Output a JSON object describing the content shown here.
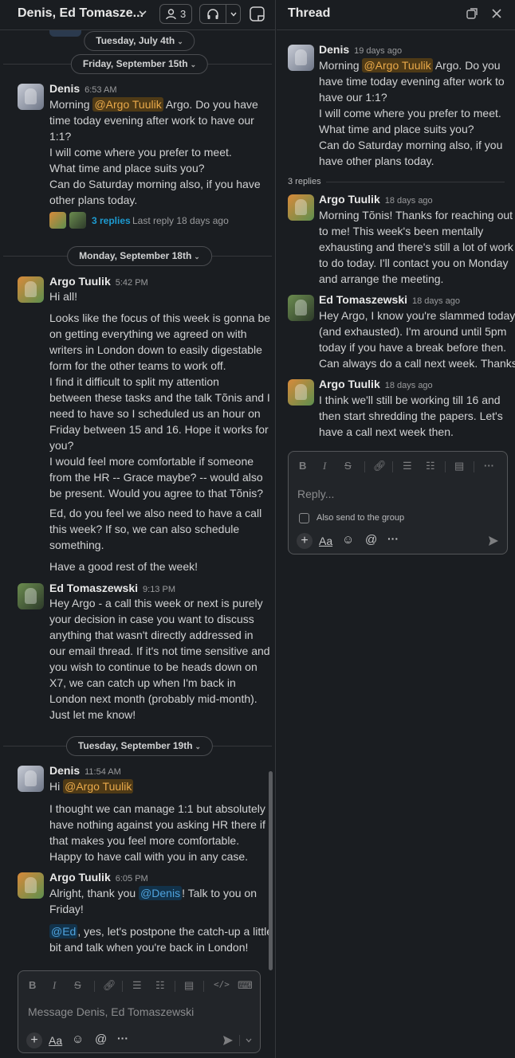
{
  "channel": {
    "title": "Denis, Ed Tomasze...",
    "member_count": "3"
  },
  "thread_panel": {
    "title": "Thread"
  },
  "date_dividers": {
    "d0": "Tuesday, July 4th",
    "d1": "Friday, September 15th",
    "d2": "Monday, September 18th",
    "d3": "Tuesday, September 19th"
  },
  "messages": [
    {
      "author": "Denis",
      "time": "6:53 AM",
      "lines": [
        "Morning ",
        "@Argo Tuulik",
        " Argo. Do you have",
        "time today evening after work to have our",
        "1:1?",
        "I will come where you prefer to meet.",
        "What time and place suits you?",
        "Can do Saturday morning also, if you have",
        "other plans today."
      ],
      "replies": "3 replies",
      "last_reply": "Last reply 18 days ago"
    },
    {
      "author": "Argo Tuulik",
      "time": "5:42 PM",
      "lines": [
        "Hi all!",
        "Looks like the focus of this week is gonna be",
        "on getting everything we agreed on with",
        "writers in London down to easily digestable",
        "form for the other teams to work off.",
        "I find it difficult to split my attention",
        "between these tasks and the talk Tõnis and I",
        "need to have so I scheduled us an hour on",
        "Friday between 15 and 16. Hope it works for",
        "you?",
        "I would feel more comfortable if someone",
        "from the HR -- Grace maybe? -- would also",
        "be present. Would you agree to that Tõnis?",
        "Ed, do you feel we also need to have a call",
        "this week? If so, we can also schedule",
        "something.",
        "Have a good rest of the week!"
      ]
    },
    {
      "author": "Ed Tomaszewski",
      "time": "9:13 PM",
      "lines": [
        "Hey Argo - a call this week or next is purely",
        "your decision in case you want to discuss",
        "anything that wasn't directly addressed in",
        "our email thread. If it's not time sensitive and",
        "you wish to continue to be heads down on",
        "X7, we can catch up when I'm back in",
        "London next month (probably mid-month).",
        "Just let me know!"
      ]
    },
    {
      "author": "Denis",
      "time": "11:54 AM",
      "lines": [
        "Hi ",
        "@Argo Tuulik",
        "I thought we can manage 1:1 but absolutely I",
        "have nothing against you asking HR there if",
        "that makes you feel more comfortable.",
        "Happy to have call with you in any case."
      ]
    },
    {
      "author": "Argo Tuulik",
      "time": "6:05 PM",
      "lines": [
        "Alright, thank you ",
        "@Denis",
        "! Talk to you on",
        "Friday!",
        "@Ed",
        ", yes, let's postpone the catch-up a little",
        "bit and talk when you're back in London!"
      ]
    }
  ],
  "composer": {
    "placeholder": "Message Denis, Ed Tomaszewski"
  },
  "thread": {
    "parent": {
      "author": "Denis",
      "time": "19 days ago",
      "lines": [
        "Morning ",
        "@Argo Tuulik",
        " Argo. Do you",
        "have time today evening after work to",
        "have our 1:1?",
        "I will come where you prefer to meet.",
        "What time and place suits you?",
        "Can do Saturday morning also, if you",
        "have other plans today."
      ]
    },
    "replies_count": "3 replies",
    "replies": [
      {
        "author": "Argo Tuulik",
        "time": "18 days ago",
        "lines": [
          "Morning Tõnis! Thanks for reaching out",
          "to me! This week's been mentally",
          "exhausting and there's still a lot of work",
          "to do today. I'll contact you on Monday",
          "and arrange the meeting."
        ]
      },
      {
        "author": "Ed Tomaszewski",
        "time": "18 days ago",
        "lines": [
          "Hey Argo, I know you're slammed today",
          "(and exhausted). I'm around until 5pm",
          "today if you have a break before then.",
          "Can always do a call next week. Thanks!"
        ]
      },
      {
        "author": "Argo Tuulik",
        "time": "18 days ago",
        "lines": [
          "I think we'll still be working till 16 and",
          "then start shredding the papers. Let's",
          "have a call next week then."
        ]
      }
    ],
    "composer": {
      "placeholder": "Reply...",
      "also_send": "Also send to the group"
    }
  },
  "icons": [
    "members-icon",
    "headphones-icon",
    "canvas-icon",
    "popout-icon",
    "close-icon",
    "bold-icon",
    "italic-icon",
    "strike-icon",
    "link-icon",
    "ordered-list-icon",
    "bullet-list-icon",
    "block-quote-icon",
    "code-icon",
    "code-block-icon",
    "plus-icon",
    "text-format-icon",
    "emoji-icon",
    "mention-icon",
    "more-icon",
    "send-icon"
  ],
  "colors": {
    "background": "#1a1d21",
    "mention_bg": "#4f3a16",
    "mention_text": "#e9a94a",
    "link": "#1d9bd1"
  }
}
